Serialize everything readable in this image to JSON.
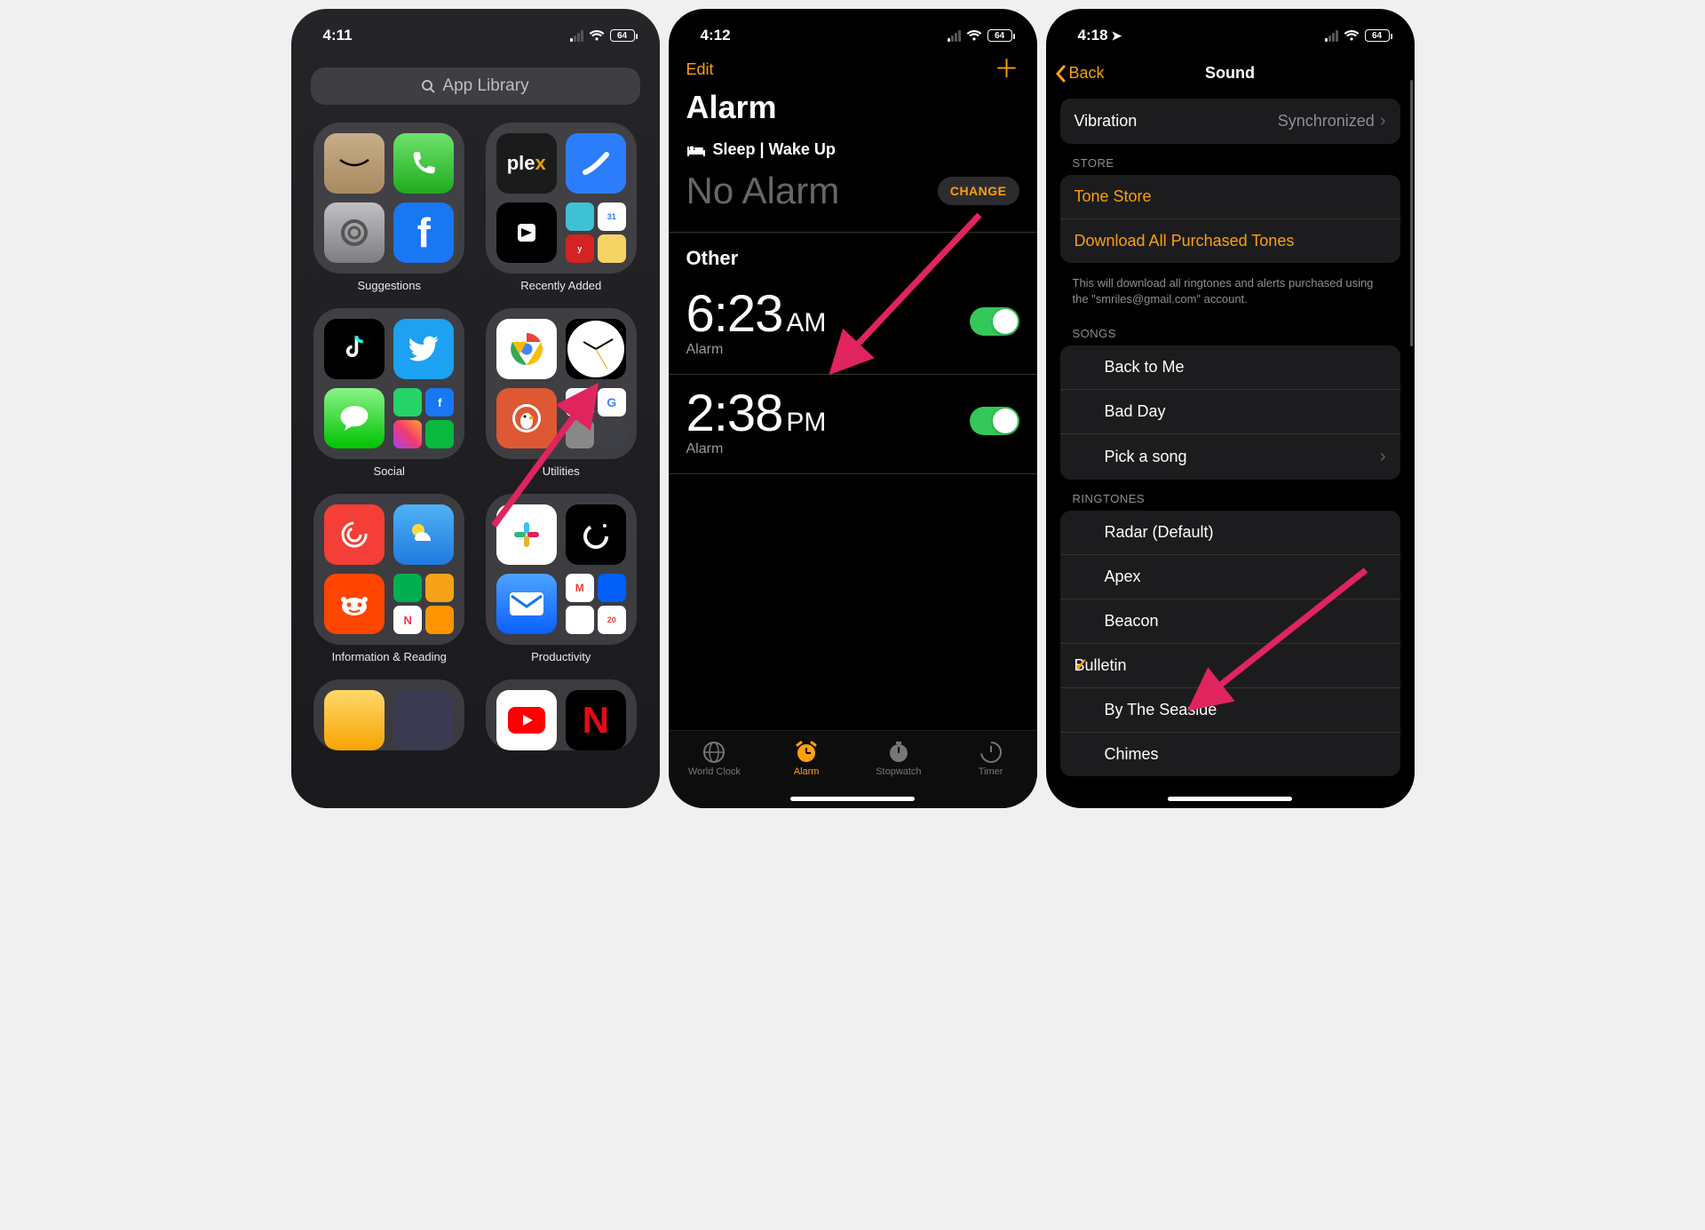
{
  "phone1": {
    "time": "4:11",
    "battery": "64",
    "search_placeholder": "App Library",
    "folders": [
      {
        "label": "Suggestions"
      },
      {
        "label": "Recently Added"
      },
      {
        "label": "Social"
      },
      {
        "label": "Utilities"
      },
      {
        "label": "Information & Reading"
      },
      {
        "label": "Productivity"
      }
    ]
  },
  "phone2": {
    "time": "4:12",
    "battery": "64",
    "edit_label": "Edit",
    "title": "Alarm",
    "sleep_header": "Sleep | Wake Up",
    "no_alarm": "No Alarm",
    "change_label": "CHANGE",
    "other_header": "Other",
    "alarms": [
      {
        "time": "6:23",
        "ampm": "AM",
        "label": "Alarm"
      },
      {
        "time": "2:38",
        "ampm": "PM",
        "label": "Alarm"
      }
    ],
    "tabs": [
      {
        "label": "World Clock"
      },
      {
        "label": "Alarm"
      },
      {
        "label": "Stopwatch"
      },
      {
        "label": "Timer"
      }
    ]
  },
  "phone3": {
    "time": "4:18",
    "battery": "64",
    "back_label": "Back",
    "title": "Sound",
    "vibration_label": "Vibration",
    "vibration_value": "Synchronized",
    "store_header": "STORE",
    "store_rows": [
      {
        "label": "Tone Store"
      },
      {
        "label": "Download All Purchased Tones"
      }
    ],
    "store_footer": "This will download all ringtones and alerts purchased using the \"smriles@gmail.com\" account.",
    "songs_header": "SONGS",
    "songs": [
      {
        "label": "Back to Me"
      },
      {
        "label": "Bad Day"
      },
      {
        "label": "Pick a song"
      }
    ],
    "ringtones_header": "RINGTONES",
    "ringtones": [
      {
        "label": "Radar (Default)",
        "selected": false
      },
      {
        "label": "Apex",
        "selected": false
      },
      {
        "label": "Beacon",
        "selected": false
      },
      {
        "label": "Bulletin",
        "selected": true
      },
      {
        "label": "By The Seaside",
        "selected": false
      },
      {
        "label": "Chimes",
        "selected": false
      }
    ]
  }
}
